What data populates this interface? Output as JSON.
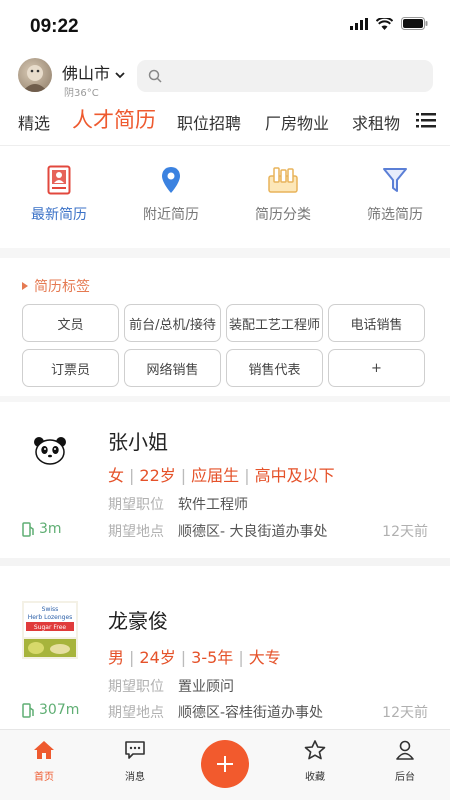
{
  "status_bar": {
    "time": "09:22"
  },
  "header": {
    "city": "佛山市",
    "weather": "阴36°C",
    "search_placeholder": ""
  },
  "tabs": [
    {
      "label": "精选",
      "active": false
    },
    {
      "label": "人才简历",
      "active": true
    },
    {
      "label": "职位招聘",
      "active": false
    },
    {
      "label": "厂房物业",
      "active": false
    },
    {
      "label": "求租物",
      "active": false
    }
  ],
  "quick_actions": [
    {
      "label": "最新简历",
      "icon": "resume-icon",
      "active": true
    },
    {
      "label": "附近简历",
      "icon": "location-pin-icon",
      "active": false
    },
    {
      "label": "简历分类",
      "icon": "category-icon",
      "active": false
    },
    {
      "label": "筛选简历",
      "icon": "filter-icon",
      "active": false
    }
  ],
  "tags_section": {
    "title": "简历标签",
    "tags": [
      "文员",
      "前台/总机/接待",
      "装配工艺工程师",
      "电话销售",
      "订票员",
      "网络销售",
      "销售代表",
      "+"
    ]
  },
  "resumes": [
    {
      "name": "张小姐",
      "gender": "女",
      "age": "22岁",
      "experience": "应届生",
      "education": "高中及以下",
      "position_label": "期望职位",
      "position": "软件工程师",
      "location_label": "期望地点",
      "location": "顺德区- 大良街道办事处",
      "distance": "3m",
      "time": "12天前",
      "thumb": "panda-icon"
    },
    {
      "name": "龙豪俊",
      "gender": "男",
      "age": "24岁",
      "experience": "3-5年",
      "education": "大专",
      "position_label": "期望职位",
      "position": "置业顾问",
      "location_label": "期望地点",
      "location": "顺德区-容桂街道办事处",
      "distance": "307m",
      "time": "12天前",
      "thumb": "lozenges-photo",
      "thumb_text": [
        "Swiss",
        "Herb Lozenges",
        "Sugar Free"
      ]
    }
  ],
  "bottom_nav": [
    {
      "label": "首页",
      "icon": "home-icon",
      "active": true
    },
    {
      "label": "消息",
      "icon": "message-icon",
      "active": false
    },
    {
      "label": "",
      "icon": "plus-icon",
      "active": false
    },
    {
      "label": "收藏",
      "icon": "star-icon",
      "active": false
    },
    {
      "label": "后台",
      "icon": "user-icon",
      "active": false
    }
  ],
  "colors": {
    "accent": "#ee5a2f",
    "blue": "#3b72c7",
    "green": "#5fae73"
  }
}
